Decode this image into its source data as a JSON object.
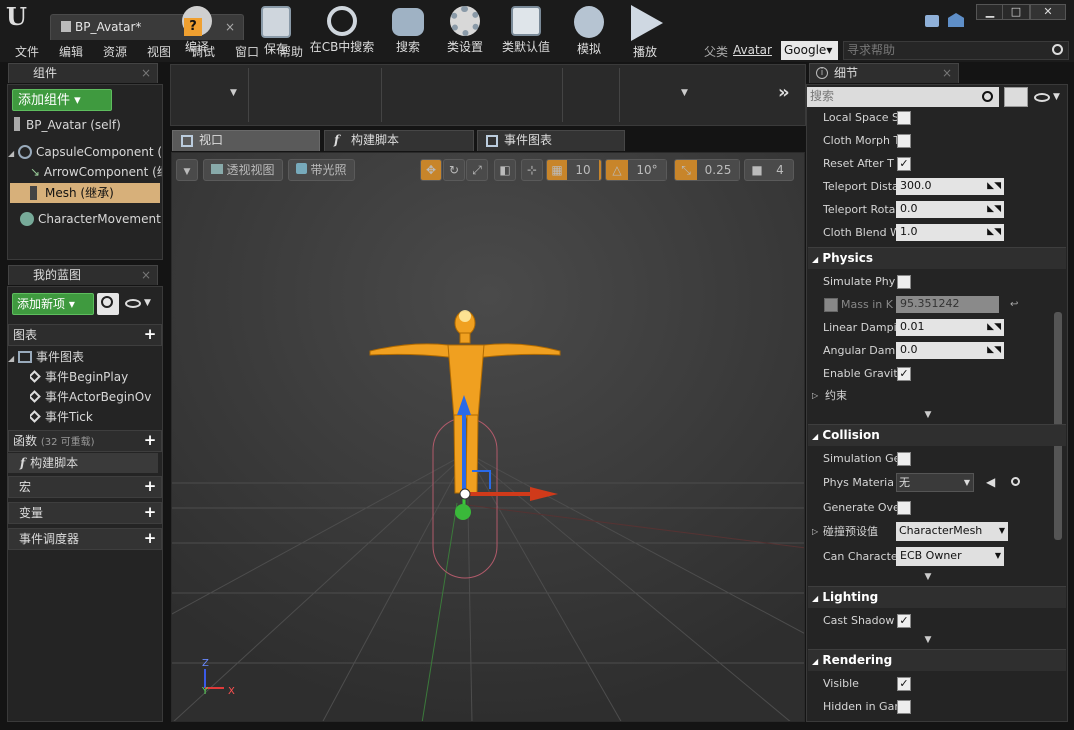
{
  "window": {
    "doc_tab": "BP_Avatar*",
    "tab_close": "×",
    "min": "▁",
    "max": "□",
    "close": "✕"
  },
  "menu": [
    "文件",
    "编辑",
    "资源",
    "视图",
    "调试",
    "窗口",
    "帮助"
  ],
  "header": {
    "parent_label": "父类",
    "parent_value": "Avatar",
    "search_engine": "Google▾",
    "help_placeholder": "寻求帮助"
  },
  "components": {
    "tab": "组件",
    "add_button": "添加组件 ▾",
    "items": [
      {
        "label": "BP_Avatar (self)"
      },
      {
        "label": "CapsuleComponent (继"
      },
      {
        "label": "ArrowComponent (继"
      },
      {
        "label": "Mesh (继承)"
      },
      {
        "label": "CharacterMovement (继"
      }
    ]
  },
  "blueprint": {
    "tab": "我的蓝图",
    "add_button": "添加新项 ▾",
    "graphs_label": "图表",
    "event_graph": "事件图表",
    "events": [
      "事件BeginPlay",
      "事件ActorBeginOv",
      "事件Tick"
    ],
    "functions_label": "函数",
    "functions_hint": "(32 可重载)",
    "construction": "构建脚本",
    "macros": "宏",
    "variables": "变量",
    "dispatchers": "事件调度器"
  },
  "toolbar": {
    "compile": "编译",
    "save": "保存",
    "find_cb": "在CB中搜索",
    "search": "搜索",
    "class_settings": "类设置",
    "class_defaults": "类默认值",
    "simulate": "模拟",
    "play": "播放"
  },
  "editor_tabs": [
    "视口",
    "构建脚本",
    "事件图表"
  ],
  "viewport": {
    "perspective": "透视视图",
    "lit": "带光照",
    "grid_snap": "10",
    "rot_snap": "10°",
    "scale_snap": "0.25",
    "cam_speed": "4",
    "axis_z": "Z",
    "axis_y": "Y",
    "axis_x": "X"
  },
  "details": {
    "tab": "细节",
    "search_placeholder": "搜索",
    "rows_top": [
      {
        "label": "Local Space S",
        "type": "check",
        "checked": false
      },
      {
        "label": "Cloth Morph T",
        "type": "check",
        "checked": false
      },
      {
        "label": "Reset After T",
        "type": "check",
        "checked": true
      },
      {
        "label": "Teleport Dista",
        "type": "num",
        "value": "300.0"
      },
      {
        "label": "Teleport Rota",
        "type": "num",
        "value": "0.0"
      },
      {
        "label": "Cloth Blend W",
        "type": "num",
        "value": "1.0"
      }
    ],
    "physics": {
      "title": "Physics",
      "simulate": "Simulate Phy",
      "mass_label": "Mass in K",
      "mass_value": "95.351242",
      "linear": "Linear Dampi",
      "linear_value": "0.01",
      "angular": "Angular Damp",
      "angular_value": "0.0",
      "gravity": "Enable Gravit",
      "constraints": "约束"
    },
    "collision": {
      "title": "Collision",
      "sim_gen": "Simulation Ge",
      "phys_material": "Phys Materia",
      "phys_material_value": "无",
      "generate_overlap": "Generate Ove",
      "preset_label": "碰撞预设值",
      "preset_value": "CharacterMesh",
      "can_character": "Can Characte",
      "can_character_value": "ECB Owner"
    },
    "lighting": {
      "title": "Lighting",
      "cast_shadow": "Cast Shadow"
    },
    "rendering": {
      "title": "Rendering",
      "visible": "Visible",
      "hidden_in_game": "Hidden in Gar"
    }
  }
}
